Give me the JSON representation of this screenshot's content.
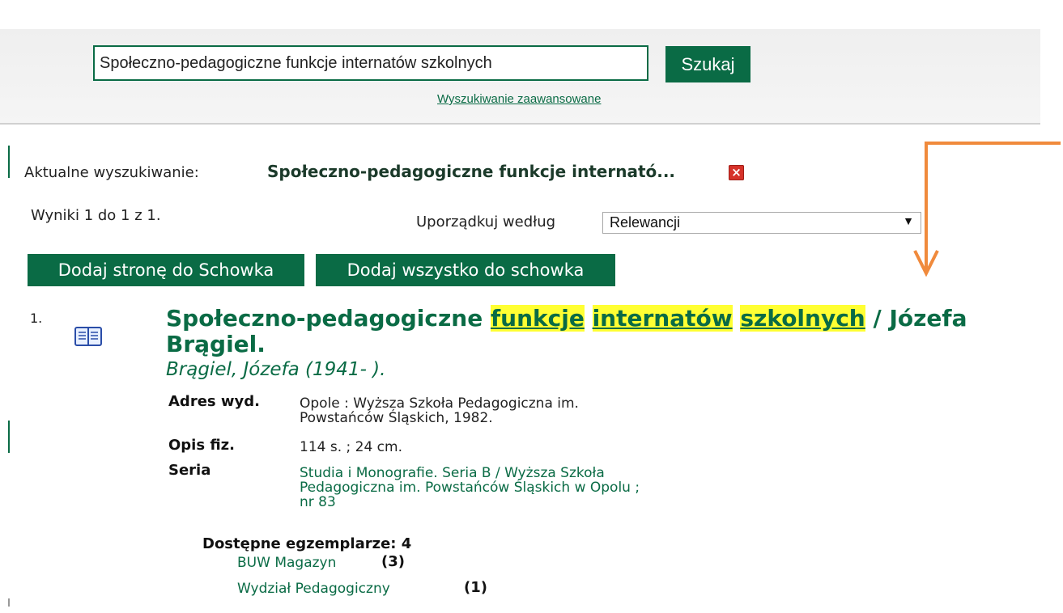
{
  "search": {
    "query": "Społeczno-pedagogiczne funkcje internatów szkolnych",
    "button_label": "Szukaj",
    "advanced_link": "Wyszukiwanie zaawansowane"
  },
  "current_search": {
    "label": "Aktualne wyszukiwanie:",
    "value": "Społeczno-pedagogiczne funkcje internató...",
    "clear_icon": "close-icon"
  },
  "results": {
    "count_text": "Wyniki 1 do 1 z 1.",
    "sort_label": "Uporządkuj według",
    "sort_selected": "Relewancji"
  },
  "actions": {
    "add_page": "Dodaj stronę do Schowka",
    "add_all": "Dodaj wszystko do schowka"
  },
  "record": {
    "number": "1.",
    "icon": "book-icon",
    "title_parts": {
      "t1": "Społeczno-pedagogiczne ",
      "t2": "funkcje",
      "t3": " ",
      "t4": "internatów",
      "t5": " ",
      "t6": "szkolnych",
      "t7": " / Józefa",
      "t8": "Brągiel."
    },
    "author": "Brągiel, Józefa (1941- ).",
    "fields": {
      "publisher_label": "Adres wyd.",
      "publisher_line1": "Opole : Wyższa Szkoła Pedagogiczna im.",
      "publisher_line2": "Powstańców Śląskich, 1982.",
      "physical_label": "Opis fiz.",
      "physical_value": "114 s. ; 24 cm.",
      "series_label": "Seria",
      "series_line1": "Studia i Monografie. Seria B / Wyższa Szkoła",
      "series_line2": "Pedagogiczna im. Powstańców Śląskich w Opolu ;",
      "series_line3": "nr 83"
    },
    "availability": {
      "label": "Dostępne egzemplarze: 4",
      "locations": [
        {
          "name": "BUW Magazyn",
          "count": "(3)"
        },
        {
          "name": "Wydział Pedagogiczny",
          "count": "(1)"
        }
      ]
    }
  },
  "colors": {
    "brand_green": "#0a6b45",
    "highlight": "#ffff33",
    "annotation_orange": "#f08a3c"
  }
}
